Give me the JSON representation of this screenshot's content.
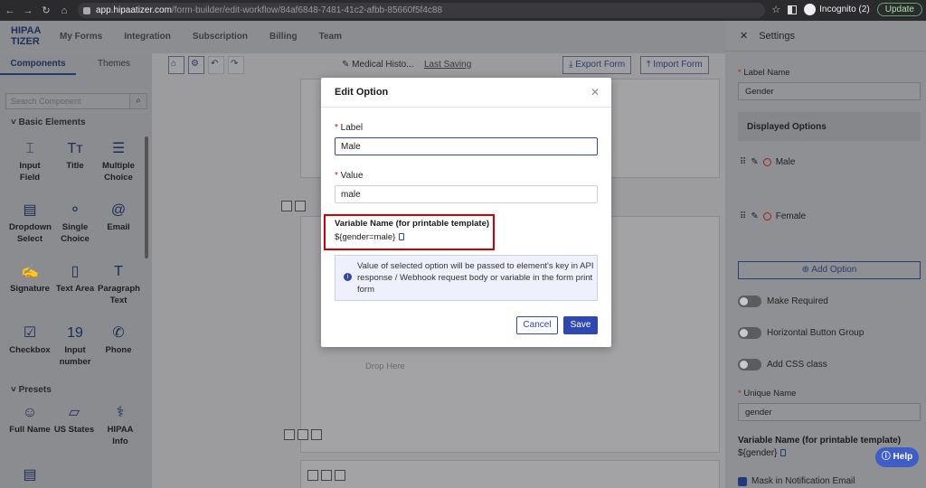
{
  "browser": {
    "url_host": "app.hipaatizer.com",
    "url_path": "/form-builder/edit-workflow/84af6848-7481-41c2-afbb-85660f5f4c88",
    "profile_label": "Incognito (2)",
    "update_label": "Update"
  },
  "app": {
    "logo_line1": "HIPAA",
    "logo_line2": "TIZER",
    "nav": [
      "My Forms",
      "Integration",
      "Subscription",
      "Billing",
      "Team"
    ]
  },
  "left_panel": {
    "tabs": [
      "Components",
      "Themes"
    ],
    "search_placeholder": "Search Component",
    "basic_title": "Basic Elements",
    "presets_title": "Presets",
    "components": [
      {
        "label": "Input Field",
        "icon": "I"
      },
      {
        "label": "Title",
        "icon": "Tт"
      },
      {
        "label": "Multiple Choice",
        "icon": "☰"
      },
      {
        "label": "Dropdown Select",
        "icon": "▤"
      },
      {
        "label": "Single Choice",
        "icon": "⚬"
      },
      {
        "label": "Email",
        "icon": "@"
      },
      {
        "label": "Signature",
        "icon": "✍"
      },
      {
        "label": "Text Area",
        "icon": "▯"
      },
      {
        "label": "Paragraph Text",
        "icon": "T"
      },
      {
        "label": "Checkbox",
        "icon": "☑"
      },
      {
        "label": "Input number",
        "icon": "19"
      },
      {
        "label": "Phone",
        "icon": "✆"
      }
    ],
    "presets": [
      {
        "label": "Full Name",
        "icon": "☺"
      },
      {
        "label": "US States",
        "icon": "▱"
      },
      {
        "label": "HIPAA Info",
        "icon": "⚕"
      }
    ]
  },
  "canvas": {
    "form_name": "Medical Histo...",
    "last_saving": "Last Saving",
    "export_label": "Export Form",
    "import_label": "Import Form",
    "drop_here": "Drop Here"
  },
  "modal": {
    "title": "Edit Option",
    "label_label": "Label",
    "label_value": "Male",
    "value_label": "Value",
    "value_value": "male",
    "var_title": "Variable Name (for printable template)",
    "var_value": "${gender=male}",
    "info_text": "Value of selected option will be passed to element's key in API response / Webhook request body or variable in the form print form",
    "cancel": "Cancel",
    "save": "Save"
  },
  "settings": {
    "title": "Settings",
    "label_name_label": "Label Name",
    "label_name_value": "Gender",
    "displayed_options": "Displayed Options",
    "options": [
      "Male",
      "Female"
    ],
    "add_option": "Add Option",
    "make_required": "Make Required",
    "horizontal_group": "Horizontal Button Group",
    "add_css": "Add CSS class",
    "unique_name_label": "Unique Name",
    "unique_name_value": "gender",
    "var_title": "Variable Name (for printable template)",
    "var_value": "${gender}",
    "mask_label": "Mask in Notification Email",
    "help": "Help"
  }
}
